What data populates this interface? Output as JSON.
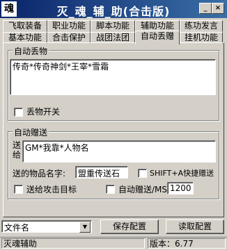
{
  "window": {
    "icon_text": "魂",
    "title": "灭_魂_辅_助(合击版)",
    "btn_min": "_",
    "btn_close": "×"
  },
  "tabs_row1": [
    "飞取装备",
    "职业功能",
    "脚本功能",
    "辅助功能",
    "练功发言"
  ],
  "tabs_row2": [
    "基本功能",
    "合击保护",
    "战团法团",
    "自动丢赠",
    "挂机功能"
  ],
  "active_tab": "自动丢赠",
  "drop_group": {
    "label": "自动丢物",
    "items_value": "传奇*传奇神剑*王宰*雪霜",
    "toggle_label": "丢物开关"
  },
  "gift_group": {
    "label": "自动赠送",
    "send_to_label": "送给",
    "send_to_value": "GM*我靠*人物名",
    "item_name_label": "送的物品名字:",
    "item_name_value": "盟重传送石",
    "shortcut_label": "SHIFT+A快捷赠送",
    "attack_target_label": "送给攻击目标",
    "auto_gift_label": "自动赠送/MS",
    "auto_gift_interval": "1200"
  },
  "bottom": {
    "file_combo_value": "文件名",
    "save_button": "保存配置",
    "load_button": "读取配置"
  },
  "status": {
    "app_name": "灭魂辅助",
    "version": "版本：6.77"
  }
}
